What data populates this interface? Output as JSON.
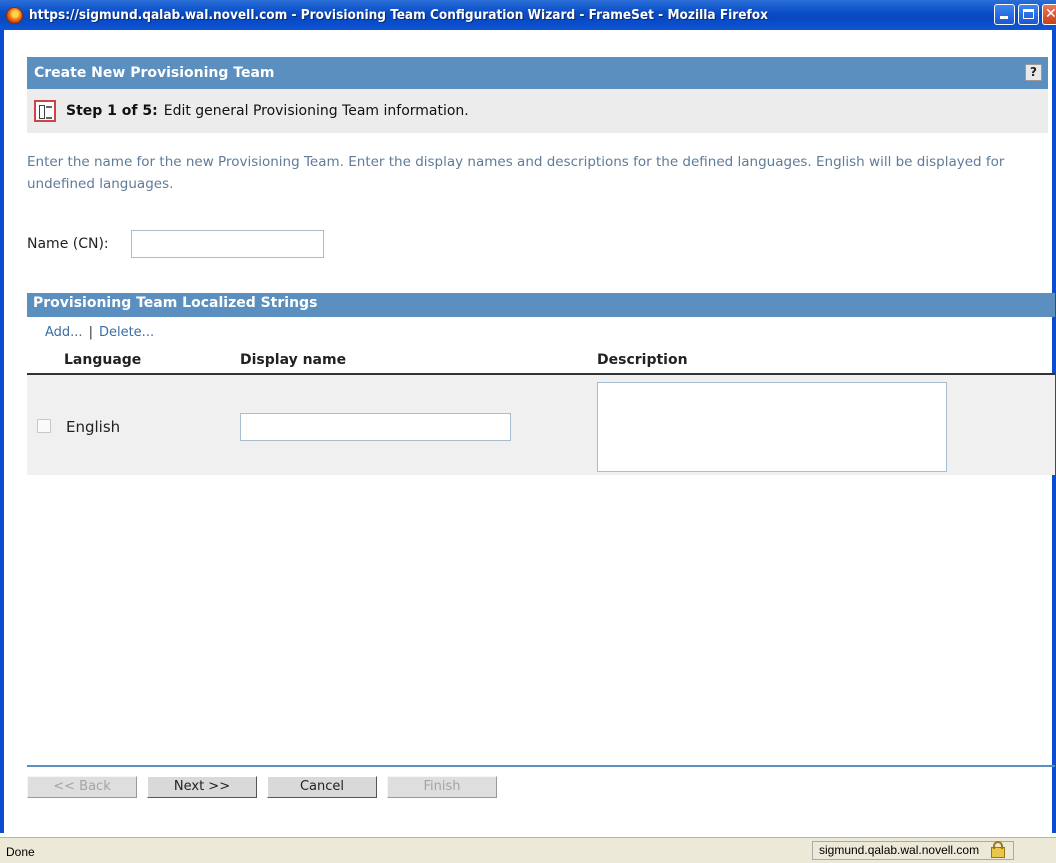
{
  "window": {
    "title": "https://sigmund.qalab.wal.novell.com - Provisioning Team Configuration Wizard - FrameSet - Mozilla Firefox"
  },
  "header": {
    "title": "Create New Provisioning Team",
    "help_label": "?"
  },
  "step": {
    "label": "Step 1 of 5:",
    "description": "Edit general Provisioning Team information."
  },
  "instructions": "Enter the name for the new Provisioning Team.  Enter the display names and descriptions for the defined languages.  English will be displayed for undefined languages.",
  "name_field": {
    "label": "Name (CN):",
    "value": ""
  },
  "localized_strings": {
    "title": "Provisioning Team Localized Strings",
    "add_label": "Add...",
    "separator": "|",
    "delete_label": "Delete...",
    "columns": [
      "Language",
      "Display name",
      "Description"
    ],
    "rows": [
      {
        "language": "English",
        "display_name": "",
        "description": "",
        "checked": false
      }
    ]
  },
  "buttons": {
    "back": "<< Back",
    "next": "Next >>",
    "cancel": "Cancel",
    "finish": "Finish"
  },
  "status": {
    "text": "Done",
    "domain": "sigmund.qalab.wal.novell.com"
  },
  "colors": {
    "header_bg": "#5a8fbf",
    "instructions_text": "#5f7b98",
    "link": "#3a6ea5"
  }
}
